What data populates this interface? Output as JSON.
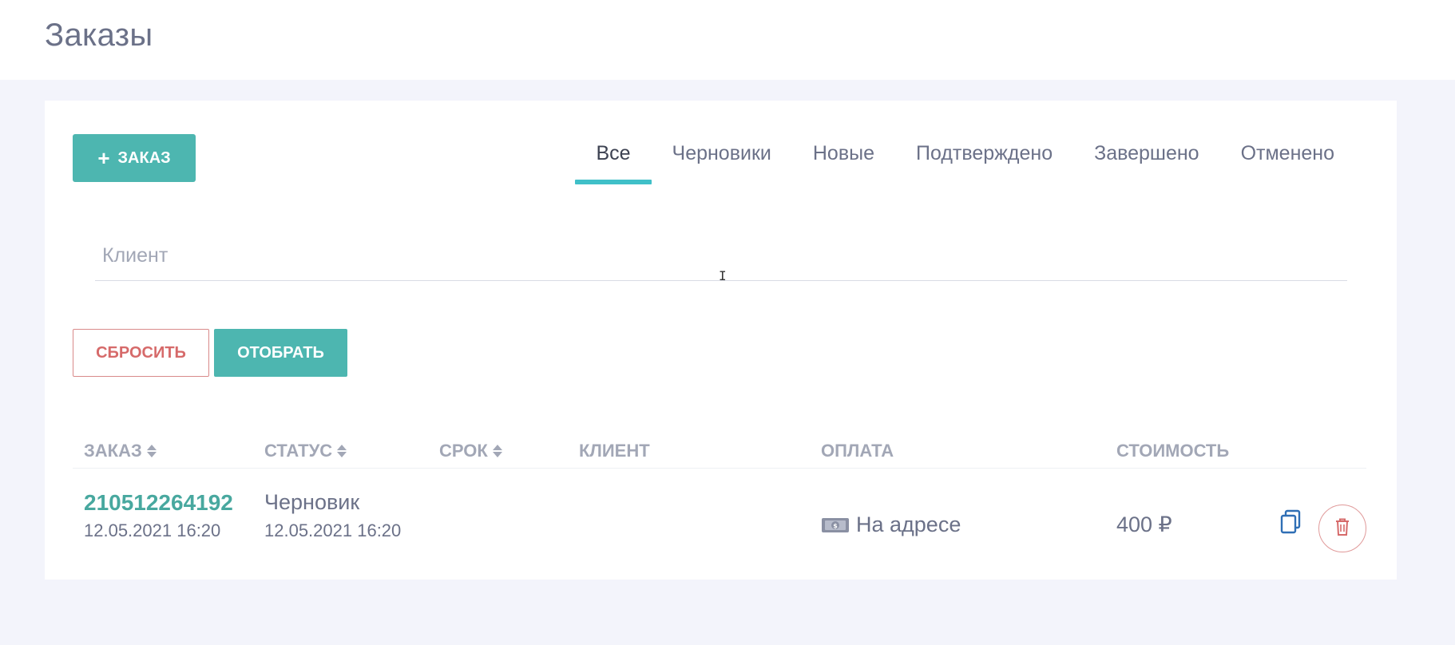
{
  "page": {
    "title": "Заказы"
  },
  "toolbar": {
    "add_label": "ЗАКАЗ"
  },
  "tabs": [
    {
      "label": "Все"
    },
    {
      "label": "Черновики"
    },
    {
      "label": "Новые"
    },
    {
      "label": "Подтверждено"
    },
    {
      "label": "Завершено"
    },
    {
      "label": "Отменено"
    }
  ],
  "active_tab": "Все",
  "filters": {
    "client_placeholder": "Клиент",
    "client_value": "",
    "reset_label": "СБРОСИТЬ",
    "apply_label": "ОТОБРАТЬ"
  },
  "table": {
    "columns": [
      {
        "label": "ЗАКАЗ",
        "sortable": true
      },
      {
        "label": "СТАТУС",
        "sortable": true
      },
      {
        "label": "СРОК",
        "sortable": true
      },
      {
        "label": "КЛИЕНТ",
        "sortable": false
      },
      {
        "label": "ОПЛАТА",
        "sortable": false
      },
      {
        "label": "СТОИМОСТЬ",
        "sortable": false
      }
    ],
    "rows": [
      {
        "order_number": "210512264192",
        "order_date": "12.05.2021 16:20",
        "status": "Черновик",
        "status_date": "12.05.2021 16:20",
        "deadline": "",
        "client": "",
        "payment": "На адресе",
        "payment_icon": "cash-icon",
        "cost": "400 ₽"
      }
    ]
  },
  "colors": {
    "accent": "#4db6b0",
    "tab_underline": "#40c0c8",
    "danger": "#d66a6a",
    "copy_icon": "#2f6fb5"
  }
}
